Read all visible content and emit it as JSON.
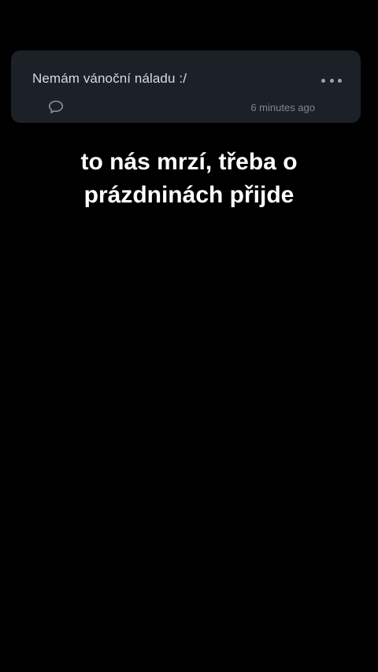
{
  "post": {
    "text": "Nemám vánoční náladu :/",
    "timestamp": "6 minutes ago",
    "more_icon": "more-horizontal-icon",
    "comment_icon": "comment-bubble-icon"
  },
  "caption": {
    "line1": "to nás mrzí, třeba o",
    "line2": "prázdninách přijde"
  },
  "colors": {
    "background": "#000000",
    "card": "#1c2128",
    "post_text": "#d6dbe1",
    "muted": "#7d8690",
    "caption_text": "#ffffff"
  }
}
